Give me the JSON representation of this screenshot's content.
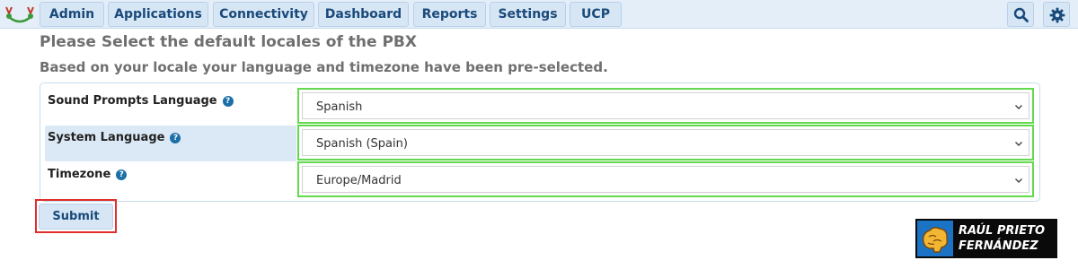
{
  "nav": {
    "items": [
      "Admin",
      "Applications",
      "Connectivity",
      "Dashboard",
      "Reports",
      "Settings",
      "UCP"
    ],
    "search_icon": "search-icon",
    "settings_icon": "gear-icon",
    "logo_icon": "freepbx-logo-icon"
  },
  "page": {
    "title": "Please Select the default locales of the PBX",
    "subtitle": "Based on your locale your language and timezone have been pre-selected."
  },
  "form": {
    "rows": [
      {
        "label": "Sound Prompts Language",
        "value": "Spanish"
      },
      {
        "label": "System Language",
        "value": "Spanish (Spain)"
      },
      {
        "label": "Timezone",
        "value": "Europe/Madrid"
      }
    ],
    "submit_label": "Submit"
  },
  "watermark": {
    "line1": "RAÚL PRIETO",
    "line2": "FERNÁNDEZ"
  },
  "colors": {
    "nav_bg": "#e4eef8",
    "button_bg": "#d6e6f5",
    "button_text": "#1a4a7a",
    "highlight_green": "#63d94f",
    "highlight_red": "#e02d2d",
    "help_icon": "#1d6fa8"
  }
}
